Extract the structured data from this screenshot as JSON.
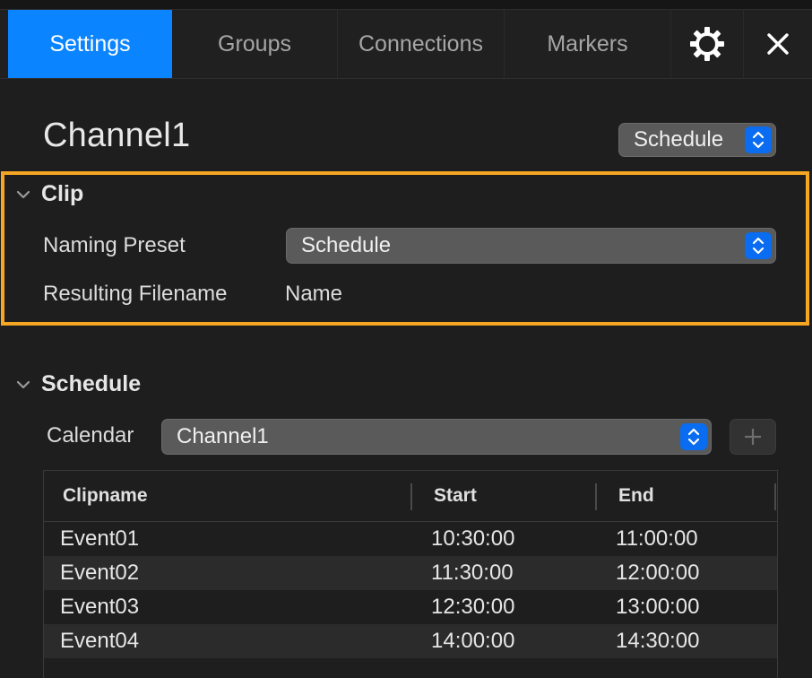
{
  "tabs": [
    {
      "label": "Settings",
      "active": true
    },
    {
      "label": "Groups",
      "active": false
    },
    {
      "label": "Connections",
      "active": false
    },
    {
      "label": "Markers",
      "active": false
    }
  ],
  "toolbar": {
    "gear_icon": "gear-icon",
    "close_icon": "close-icon"
  },
  "channel": {
    "title": "Channel1",
    "mode": "Schedule"
  },
  "clip": {
    "header": "Clip",
    "naming_preset_label": "Naming Preset",
    "naming_preset_value": "Schedule",
    "resulting_filename_label": "Resulting Filename",
    "resulting_filename_value": "Name"
  },
  "schedule": {
    "header": "Schedule",
    "calendar_label": "Calendar",
    "calendar_value": "Channel1",
    "table": {
      "columns": [
        "Clipname",
        "Start",
        "End"
      ],
      "rows": [
        [
          "Event01",
          "10:30:00",
          "11:00:00"
        ],
        [
          "Event02",
          "11:30:00",
          "12:00:00"
        ],
        [
          "Event03",
          "12:30:00",
          "13:00:00"
        ],
        [
          "Event04",
          "14:00:00",
          "14:30:00"
        ]
      ]
    }
  },
  "colors": {
    "accent": "#0a84ff",
    "highlight_border": "#f5a623",
    "background": "#1e1e1e"
  }
}
